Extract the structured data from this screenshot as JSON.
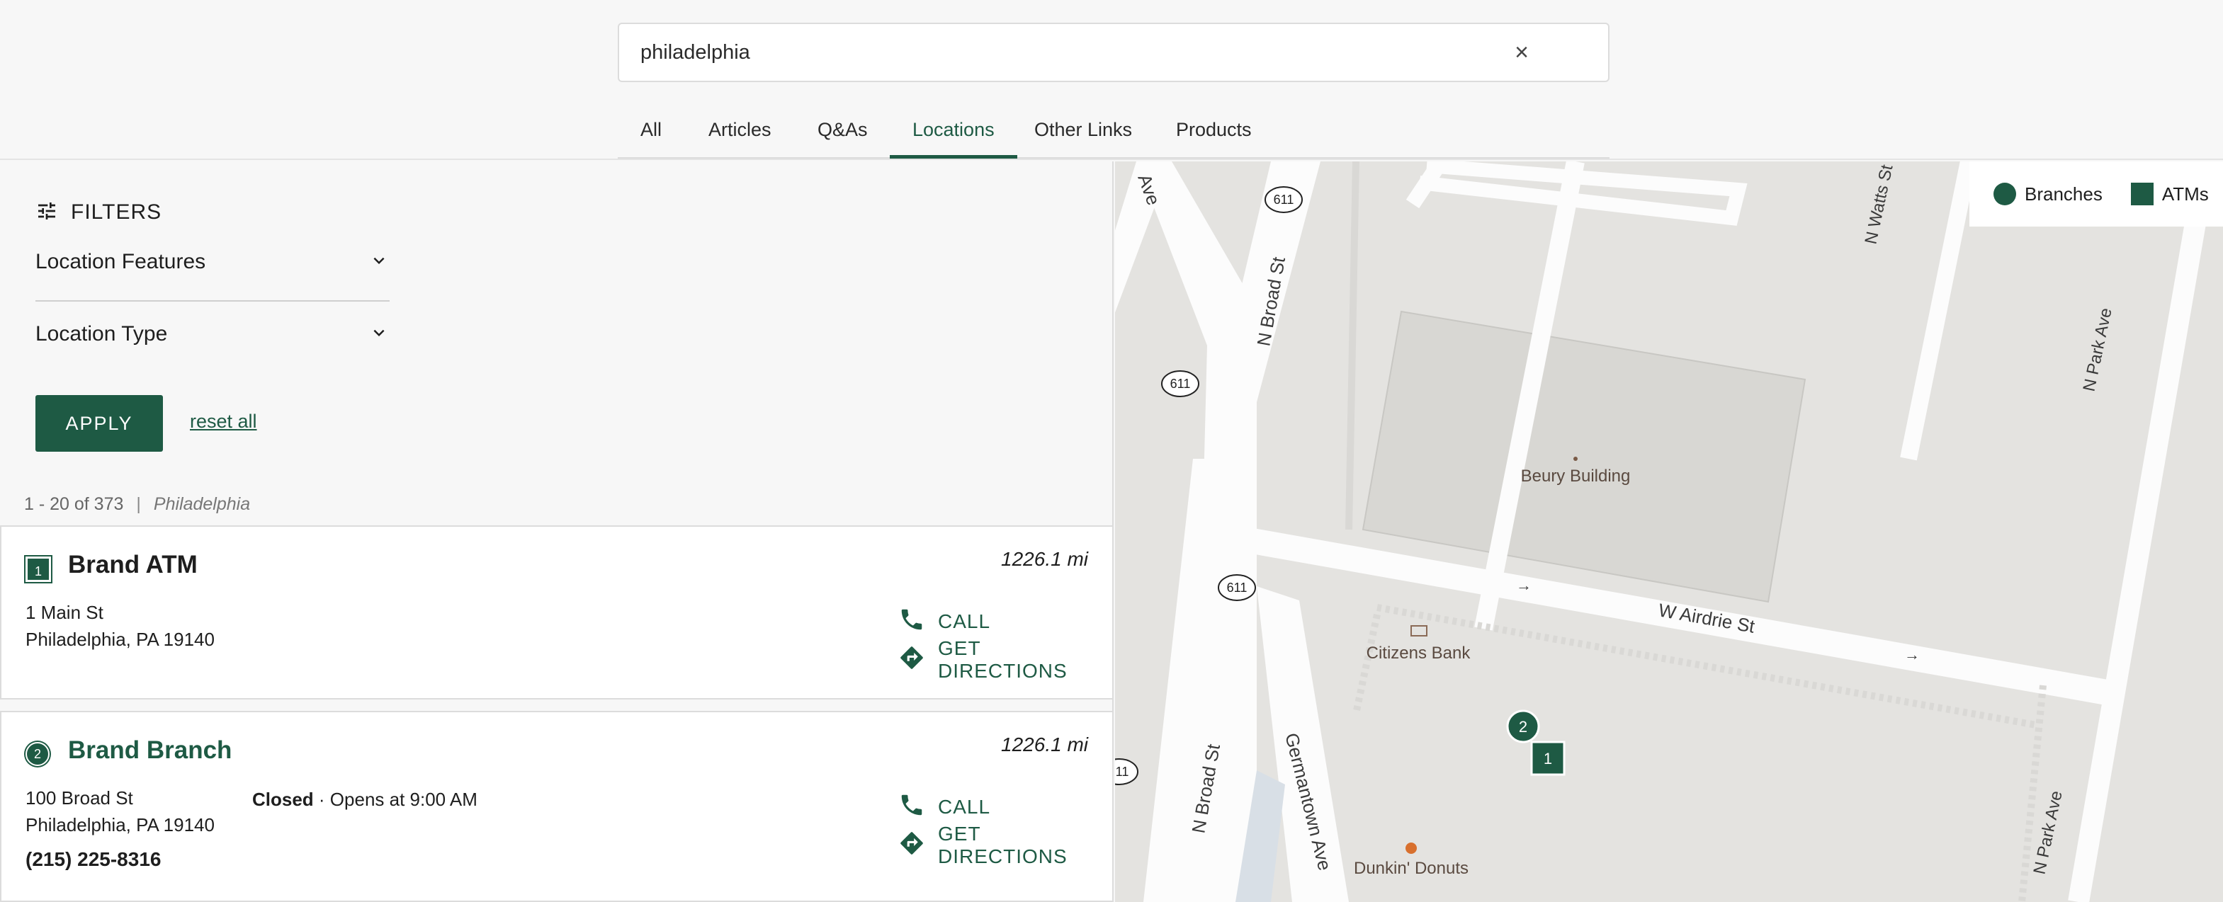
{
  "search": {
    "value": "philadelphia",
    "clear_icon": "×"
  },
  "tabs": [
    {
      "label": "All"
    },
    {
      "label": "Articles"
    },
    {
      "label": "Q&As"
    },
    {
      "label": "Locations",
      "active": true
    },
    {
      "label": "Other Links"
    },
    {
      "label": "Products"
    }
  ],
  "filters": {
    "title": "FILTERS",
    "items": [
      {
        "label": "Location Features"
      },
      {
        "label": "Location Type"
      }
    ],
    "apply_label": "APPLY",
    "reset_label": "reset all"
  },
  "results": {
    "range": "1 - 20 of 373",
    "separator": "|",
    "query": "Philadelphia"
  },
  "cards": [
    {
      "badge": "1",
      "title": "Brand ATM",
      "distance": "1226.1 mi",
      "address_line1": "1 Main St",
      "address_line2": "Philadelphia, PA 19140",
      "call_label": "CALL",
      "directions_label": "GET DIRECTIONS"
    },
    {
      "badge": "2",
      "title": "Brand Branch",
      "distance": "1226.1 mi",
      "address_line1": "100 Broad St",
      "address_line2": "Philadelphia, PA 19140",
      "status": "Closed",
      "hours": "· Opens at 9:00 AM",
      "phone": "(215) 225-8316",
      "call_label": "CALL",
      "directions_label": "GET DIRECTIONS"
    }
  ],
  "map": {
    "legend": {
      "branches": "Branches",
      "atms": "ATMs"
    },
    "streets": {
      "n_broad_st": "N Broad St",
      "w_airdrie_st": "W Airdrie St",
      "germantown_ave": "Germantown Ave",
      "n_watts_st": "N Watts St",
      "n_park_ave": "N Park Ave",
      "ave_fragment": "Ave"
    },
    "route_shield": "611",
    "route_shield_partial": "11",
    "pois": {
      "beury": "Beury Building",
      "citizens": "Citizens Bank",
      "dunkin": "Dunkin' Donuts"
    },
    "markers": {
      "branch": "2",
      "atm": "1"
    },
    "colors": {
      "brand": "#1e5a44",
      "land": "#e4e3e0",
      "road": "#fcfcfc",
      "building": "#d8d7d3"
    }
  }
}
